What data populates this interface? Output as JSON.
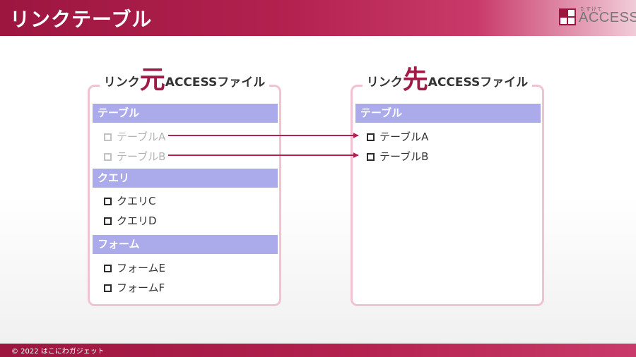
{
  "header": {
    "title": "リンクテーブル"
  },
  "logo": {
    "subtitle": "たすけて",
    "text": "ACCESS"
  },
  "left_panel": {
    "title_prefix": "リンク",
    "title_big": "元",
    "title_suffix": "ACCESSファイル",
    "sections": [
      {
        "heading": "テーブル",
        "items": [
          "テーブルA",
          "テーブルB"
        ]
      },
      {
        "heading": "クエリ",
        "items": [
          "クエリC",
          "クエリD"
        ]
      },
      {
        "heading": "フォーム",
        "items": [
          "フォームE",
          "フォームF"
        ]
      }
    ]
  },
  "right_panel": {
    "title_prefix": "リンク",
    "title_big": "先",
    "title_suffix": "ACCESSファイル",
    "sections": [
      {
        "heading": "テーブル",
        "items": [
          "テーブルA",
          "テーブルB"
        ]
      }
    ]
  },
  "colors": {
    "accent": "#a01a47",
    "section_fill": "#abaaea",
    "panel_border": "#f0c3d2",
    "arrow": "#b3214f"
  },
  "footer": {
    "text": "© 2022 はこにわガジェット"
  }
}
